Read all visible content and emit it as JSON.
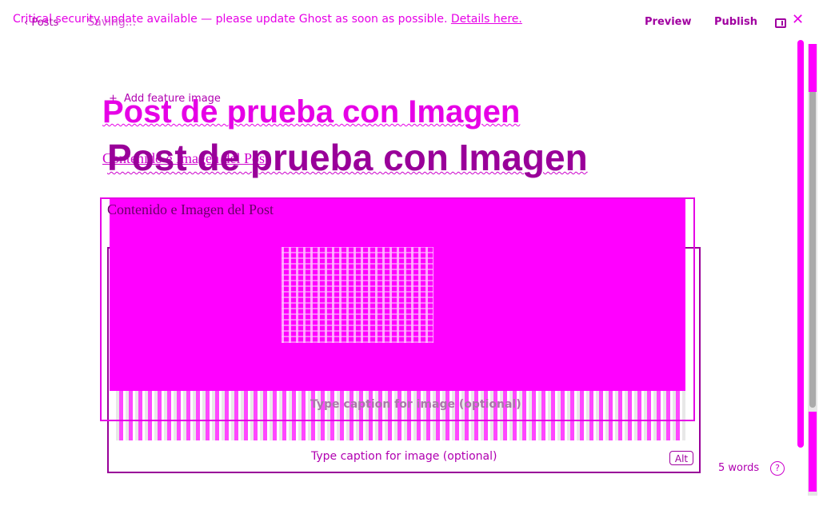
{
  "notice": {
    "text": "Critical security update available — please update Ghost as soon as possible.",
    "link": "Details here."
  },
  "toolbar": {
    "back_label": "Posts",
    "status": "Saving...",
    "preview_label": "Preview",
    "publish_label": "Publish"
  },
  "editor": {
    "add_feature_label": "Add feature image",
    "title": "Post de prueba con Imagen",
    "content": "Contenido e Imagen del Post",
    "caption_placeholder": "Type caption for image (optional)",
    "alt_label": "Alt",
    "word_count": "5 words"
  },
  "colors": {
    "accent": "#e600e6",
    "accent_dark": "#990099"
  }
}
